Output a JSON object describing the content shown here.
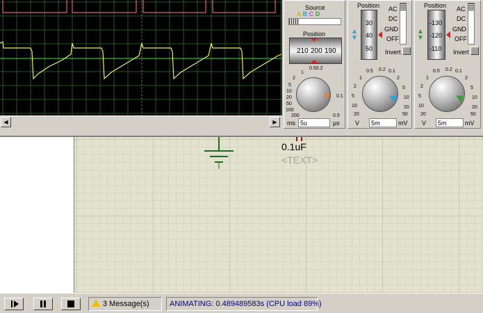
{
  "scope": {
    "source_title": "Source",
    "source_channels": [
      "A",
      "B",
      "C",
      "D"
    ],
    "position_title": "Position",
    "position_ticks": [
      "210",
      "200",
      "190"
    ],
    "timebase_scale": [
      "0.50.2",
      "1",
      "2",
      "5",
      "10",
      "20",
      "50",
      "100",
      "200",
      "0.1",
      "0.5"
    ],
    "timebase_value": "5u",
    "timebase_unit_left": "ms",
    "timebase_unit_right": "µs",
    "ch1": {
      "position_title": "Position",
      "drum_ticks": [
        "30",
        "40",
        "50"
      ],
      "coupling": [
        "AC",
        "DC",
        "GND",
        "OFF"
      ],
      "invert_label": "Invert",
      "scale": [
        "0.5",
        "0.2",
        "0.1",
        "1",
        "2",
        "5",
        "10",
        "20",
        "50",
        "2",
        "5",
        "10",
        "20",
        "50",
        "100"
      ],
      "unit_left": "V",
      "value": "5m",
      "unit_right": "mV"
    },
    "ch2": {
      "position_title": "Position",
      "drum_ticks": [
        "-130",
        "-120",
        "-110"
      ],
      "coupling": [
        "AC",
        "DC",
        "GND",
        "OFF"
      ],
      "invert_label": "Invert",
      "scale": [
        "0.5",
        "0.2",
        "0.1",
        "1",
        "2",
        "5",
        "10",
        "20",
        "50",
        "2",
        "5",
        "10",
        "20",
        "50",
        "100"
      ],
      "unit_left": "V",
      "value": "5m",
      "unit_right": "mV"
    }
  },
  "schematic": {
    "capacitor_value": "0.1uF",
    "capacitor_text": "<TEXT>"
  },
  "status": {
    "messages": "3 Message(s)",
    "animating": "ANIMATING: 0.489489583s (CPU load 89%)"
  },
  "colors": {
    "trace_pink": "#e05a8a",
    "trace_yellow": "#f0f060",
    "trace_green": "#40e040",
    "grid": "#1f5a1f"
  }
}
